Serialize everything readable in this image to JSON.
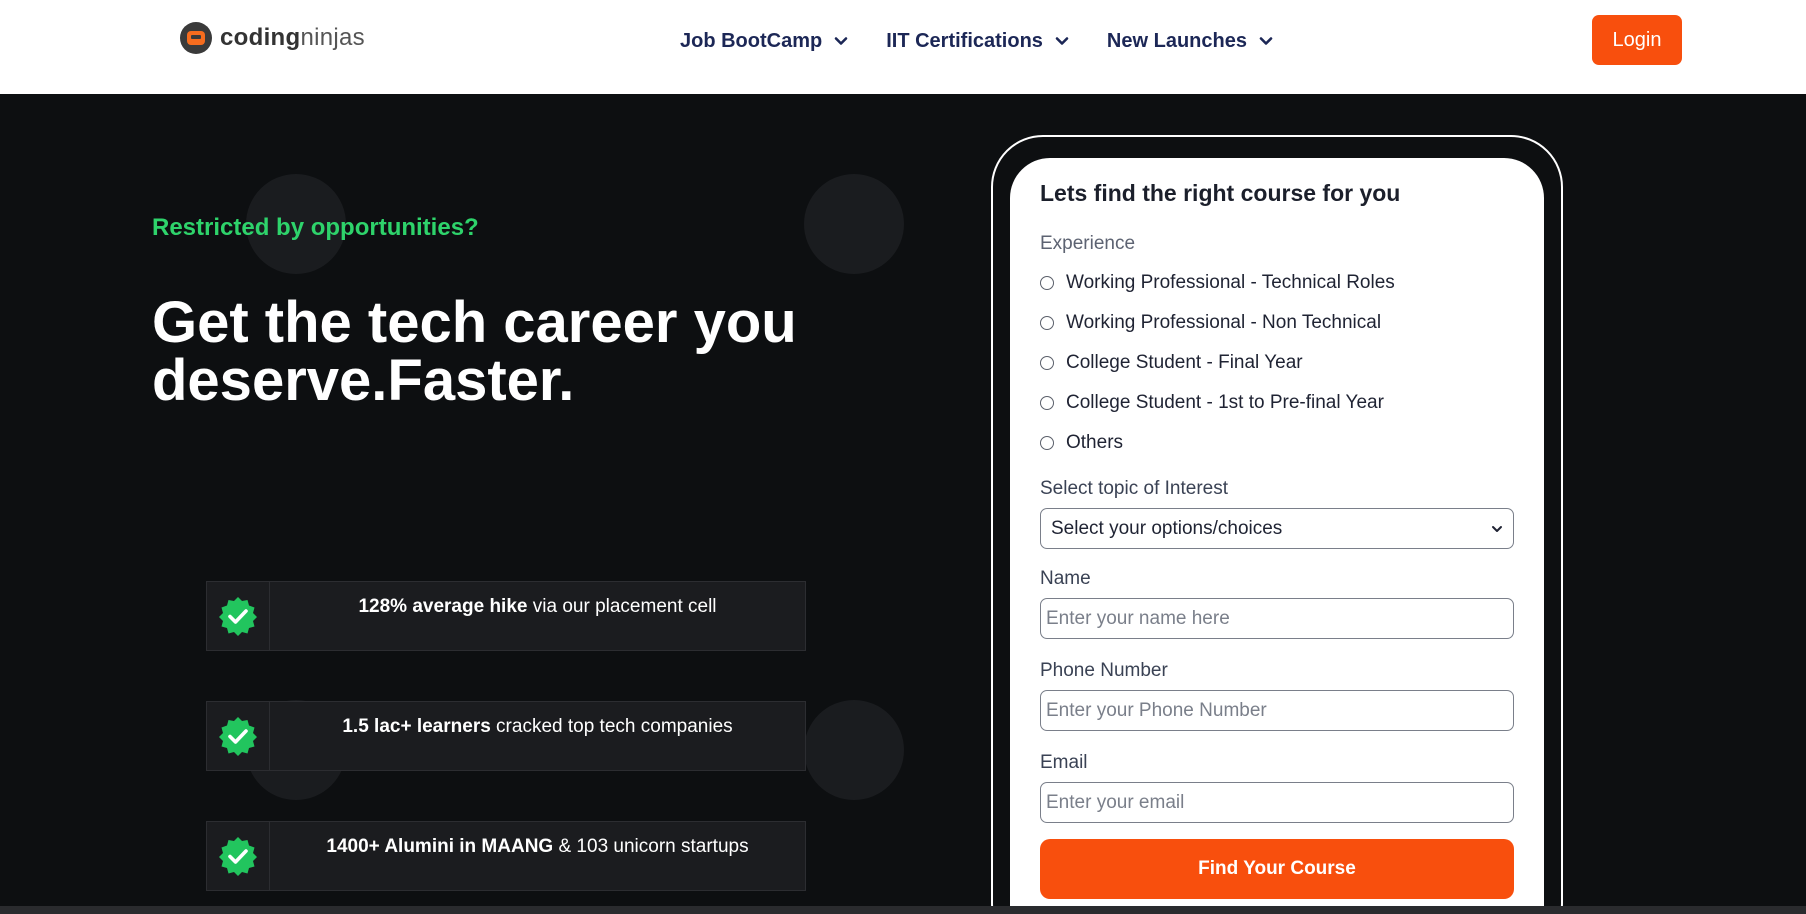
{
  "nav": {
    "logo": {
      "bold": "coding",
      "light": "ninjas"
    },
    "menu": [
      {
        "label": "Job BootCamp"
      },
      {
        "label": "IIT Certifications"
      },
      {
        "label": "New Launches"
      }
    ],
    "login_label": "Login"
  },
  "hero": {
    "tagline": "Restricted by opportunities?",
    "headline_line1": "Get the tech career you",
    "headline_line2": "deserve.Faster.",
    "stats": [
      {
        "bold": "128% average hike",
        "rest": " via our placement cell"
      },
      {
        "bold": "1.5 lac+ learners",
        "rest": " cracked top tech companies"
      },
      {
        "bold": "1400+ Alumini in MAANG",
        "rest": " & 103 unicorn startups"
      }
    ]
  },
  "form": {
    "title": "Lets find the right course for you",
    "experience_label": "Experience",
    "experience_options": [
      "Working Professional - Technical Roles",
      "Working Professional - Non Technical",
      "College Student - Final Year",
      "College Student - 1st to Pre-final Year",
      "Others"
    ],
    "topic_label": "Select topic of Interest",
    "topic_selected": "Select your options/choices",
    "name_label": "Name",
    "name_placeholder": "Enter your name here",
    "phone_label": "Phone Number",
    "phone_placeholder": "Enter your Phone Number",
    "email_label": "Email",
    "email_placeholder": "Enter your email",
    "submit_label": "Find Your Course"
  },
  "colors": {
    "accent": "#f84f0d",
    "tagline_green": "#2ed36b",
    "nav_text": "#1c2756",
    "badge_green": "#22c55e"
  },
  "icons": [
    "chevron-down-icon",
    "verified-check-icon",
    "coding-ninjas-logo"
  ]
}
